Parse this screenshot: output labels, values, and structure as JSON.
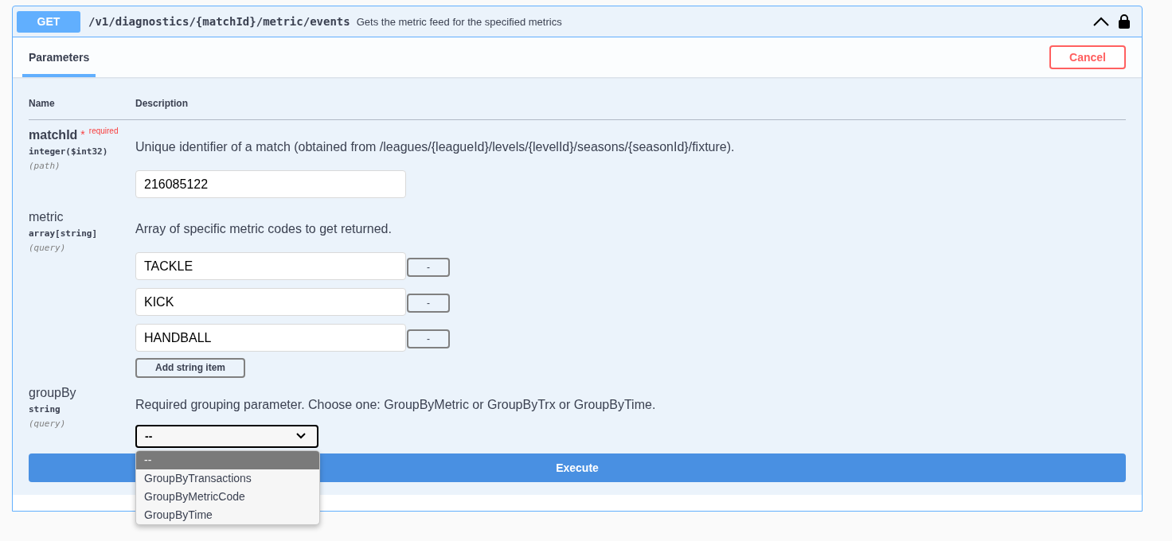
{
  "operation": {
    "method": "GET",
    "path": "/v1/diagnostics/{matchId}/metric/events",
    "summary": "Gets the metric feed for the specified metrics",
    "expanded": true
  },
  "tabs": [
    {
      "label": "Parameters",
      "selected": true
    }
  ],
  "cancel_button": "Cancel",
  "table": {
    "columns": [
      "Name",
      "Description"
    ]
  },
  "parameters": [
    {
      "kind": "text",
      "name": "matchId",
      "required": true,
      "required_mark": "*",
      "required_label": "required",
      "type": "integer($int32)",
      "location": "(path)",
      "description": "Unique identifier of a match (obtained from /leagues/{leagueId}/levels/{levelId}/seasons/{seasonId}/fixture).",
      "value": "216085122"
    },
    {
      "kind": "array",
      "name": "metric",
      "required": false,
      "type": "array[string]",
      "location": "(query)",
      "description": "Array of specific metric codes to get returned.",
      "items": [
        {
          "value": "TACKLE",
          "remove": "-"
        },
        {
          "value": "KICK",
          "remove": "-"
        },
        {
          "value": "HANDBALL",
          "remove": "-"
        }
      ],
      "add_button": "Add string item"
    },
    {
      "kind": "select",
      "name": "groupBy",
      "required": false,
      "type": "string",
      "location": "(query)",
      "description": "Required grouping parameter. Choose one: GroupByMetric or GroupByTrx or GroupByTime.",
      "value": "--",
      "expanded": true,
      "options": [
        {
          "label": "--",
          "selected": true
        },
        {
          "label": "GroupByTransactions",
          "selected": false
        },
        {
          "label": "GroupByMetricCode",
          "selected": false
        },
        {
          "label": "GroupByTime",
          "selected": false
        }
      ]
    }
  ],
  "execute_button": "Execute"
}
